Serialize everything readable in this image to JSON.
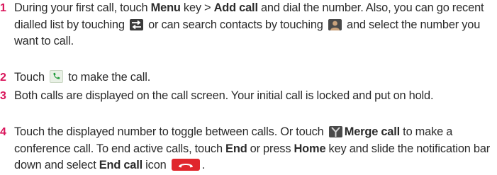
{
  "colors": {
    "step_number": "#d9145a",
    "end_call_button": "#e0262c"
  },
  "steps": [
    {
      "number": "1",
      "parts": [
        "During your first call, touch ",
        "Menu",
        " key > ",
        "Add call",
        " and dial the number. Also, you can go recent dialled list by touching ",
        " or can search contacts by touching ",
        " and select the number you want to call."
      ],
      "icons": [
        "recent-calls-icon",
        "contacts-icon"
      ]
    },
    {
      "number": "2",
      "parts": [
        "Touch ",
        " to make the call."
      ],
      "icons": [
        "phone-call-icon"
      ]
    },
    {
      "number": "3",
      "parts": [
        "Both calls are displayed on the call screen. Your initial call is locked and put on hold."
      ]
    },
    {
      "number": "4",
      "parts": [
        "Touch the displayed number to toggle between calls. Or touch ",
        "Merge call",
        " to make a conference call. To end active calls, touch ",
        "End",
        " or press ",
        "Home",
        " key and slide the notification bar down and select ",
        "End call",
        " icon ",
        "."
      ],
      "icons": [
        "merge-call-icon",
        "end-call-icon"
      ]
    }
  ]
}
